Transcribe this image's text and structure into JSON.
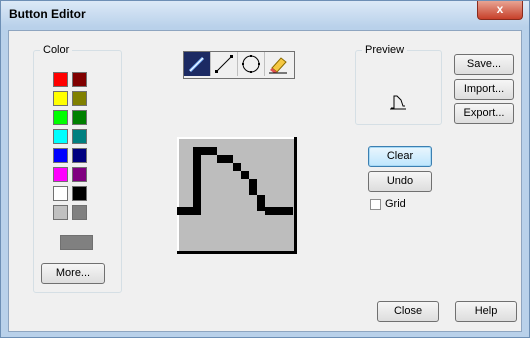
{
  "window": {
    "title": "Button Editor",
    "close_glyph": "x"
  },
  "color_group": {
    "label": "Color",
    "swatches": [
      "#ff0000",
      "#800000",
      "#ffff00",
      "#808000",
      "#00ff00",
      "#008000",
      "#00ffff",
      "#008080",
      "#0000ff",
      "#000080",
      "#ff00ff",
      "#800080",
      "#ffffff",
      "#000000",
      "#c0c0c0",
      "#808080"
    ],
    "more_label": "More..."
  },
  "tools": [
    "pencil-icon",
    "line-icon",
    "ellipse-icon",
    "eraser-icon"
  ],
  "preview": {
    "label": "Preview"
  },
  "buttons": {
    "save": "Save...",
    "import": "Import...",
    "export": "Export...",
    "clear": "Clear",
    "undo": "Undo",
    "close": "Close",
    "help": "Help"
  },
  "grid": {
    "label": "Grid",
    "checked": false
  },
  "colors": {
    "accent": "#3c7fb1",
    "title_bg": "#b9d1ea",
    "close_red": "#c7402a"
  }
}
